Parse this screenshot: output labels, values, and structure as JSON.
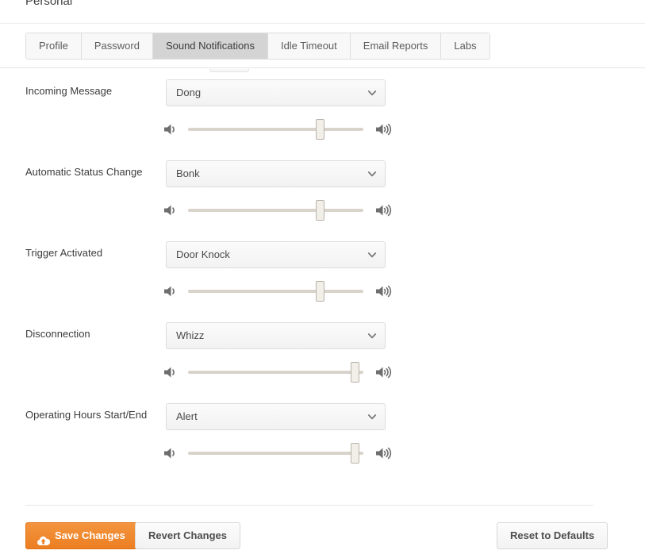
{
  "header": {
    "title": "Personal"
  },
  "tabs": [
    {
      "label": "Profile",
      "active": false
    },
    {
      "label": "Password",
      "active": false
    },
    {
      "label": "Sound Notifications",
      "active": true
    },
    {
      "label": "Idle Timeout",
      "active": false
    },
    {
      "label": "Email Reports",
      "active": false
    },
    {
      "label": "Labs",
      "active": false
    }
  ],
  "sound_rows": [
    {
      "label": "Incoming Message",
      "sound": "Dong",
      "volume": 75,
      "low_icon": "speaker-low-icon",
      "high_icon": "speaker-high-icon",
      "chevron": "chevron-down-icon"
    },
    {
      "label": "Automatic Status Change",
      "sound": "Bonk",
      "volume": 75,
      "low_icon": "speaker-low-icon",
      "high_icon": "speaker-high-icon",
      "chevron": "chevron-down-icon"
    },
    {
      "label": "Trigger Activated",
      "sound": "Door Knock",
      "volume": 75,
      "low_icon": "speaker-low-icon",
      "high_icon": "speaker-high-icon",
      "chevron": "chevron-down-icon"
    },
    {
      "label": "Disconnection",
      "sound": "Whizz",
      "volume": 95,
      "low_icon": "speaker-low-icon",
      "high_icon": "speaker-high-icon",
      "chevron": "chevron-down-icon"
    },
    {
      "label": "Operating Hours Start/End",
      "sound": "Alert",
      "volume": 95,
      "low_icon": "speaker-low-icon",
      "high_icon": "speaker-high-icon",
      "chevron": "chevron-down-icon"
    }
  ],
  "footer": {
    "save_label": "Save Changes",
    "save_icon": "cloud-upload-icon",
    "revert_label": "Revert Changes",
    "reset_label": "Reset to Defaults"
  },
  "colors": {
    "primary": "#ec7e22",
    "active_tab": "#d4d4d4",
    "slider_track": "#d8d3cb",
    "text": "#3c3c3c"
  }
}
